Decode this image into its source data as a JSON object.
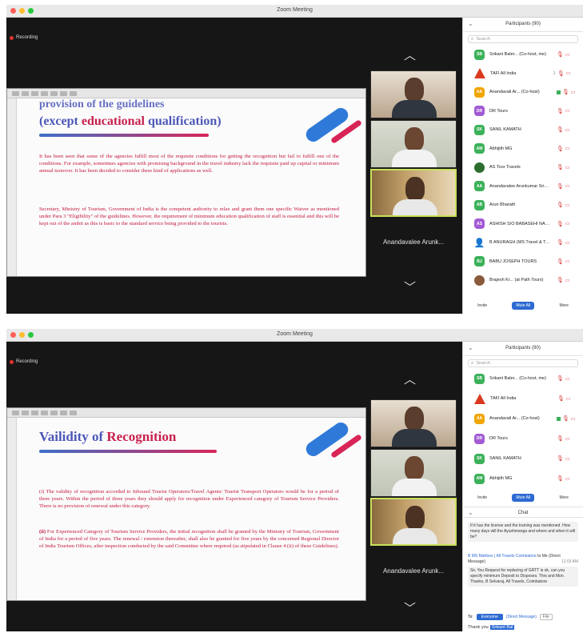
{
  "window_title": "Zoom Meeting",
  "recording_label": "Recording",
  "participants_title": "Participants (90)",
  "search_placeholder": "Search",
  "tile_name": "Anandavalee Arunk...",
  "footer": {
    "invite": "Invite",
    "mute_all": "Mute All",
    "more": "More"
  },
  "slide1": {
    "heading_line1": "provision of the guidelines",
    "heading_line2_a": "(except ",
    "heading_line2_b": "educational",
    "heading_line2_c": " qualification)",
    "para1": "It has been seen that some of the agencies fulfill most of the requisite conditions for getting the recognition but fail to fulfill one of the conditions. For example, sometimes agencies with promising background in the travel industry lack the requisite paid up capital or minimum annual turnover. It has been decided to consider these kind of applications as well.",
    "para2": "Secretary, Ministry of Tourism, Government of India is the competent authority to relax and grant them one specific Waiver as mentioned under Para 3 \"Eligibility\" of the guidelines. However, the requirement of minimum education qualification of staff is essential and this will be kept out of the ambit as this is basic to the standard service being provided to the tourists."
  },
  "slide2": {
    "heading_a": "Vailidity",
    "heading_b": " of ",
    "heading_c": "Recognition",
    "para1": "(i) The validity of recognition accorded to Inbound Tourist Operators/Travel Agents/ Tourist Transport Operators would be for a period of three years. Within the period of three years they should apply for recognition under Experienced category of Tourism Service Providers. There is no provision of renewal under this category.",
    "para2_lead": "(ii)",
    "para2": " For Experienced Category of Tourism Service Providers, the initial recognition shall be granted by the Ministry of Tourism, Government of India for a period of five years. The renewal / extension thereafter, shall also be granted for five years by the concerned Regional Director of India Tourism Offices, after inspection conducted by the said Committee where required (as stipulated in Clause 4 (ii) of these Guidelines)."
  },
  "participants1": [
    {
      "name": "Srikant Baler... (Co-host, me)",
      "avatar": "SB",
      "color": "#3cb15a",
      "type": "box",
      "badge": "",
      "cam": false
    },
    {
      "name": "TAFI All India",
      "avatar": "",
      "color": "#d93a1f",
      "type": "triangle",
      "badge": "1",
      "cam": false
    },
    {
      "name": "Anandavali Ar... (Co-host)",
      "avatar": "AA",
      "color": "#f0a500",
      "type": "box",
      "badge": "",
      "cam": true
    },
    {
      "name": "DR Tours",
      "avatar": "DR",
      "color": "#a25bd4",
      "type": "box",
      "badge": "",
      "cam": false
    },
    {
      "name": "SANIL KAMATH",
      "avatar": "SK",
      "color": "#3cb15a",
      "type": "box",
      "badge": "",
      "cam": false
    },
    {
      "name": "Abhijith MG",
      "avatar": "AM",
      "color": "#3cb15a",
      "type": "box",
      "badge": "",
      "cam": false
    },
    {
      "name": "AS Tour Travels",
      "avatar": "",
      "color": "#2b6e2f",
      "type": "photo",
      "badge": "",
      "cam": false
    },
    {
      "name": "Anandavalee Arunkumar Srikant",
      "avatar": "AA",
      "color": "#3cb15a",
      "type": "box",
      "badge": "",
      "cam": false
    },
    {
      "name": "Arun Bharath",
      "avatar": "AB",
      "color": "#3cb15a",
      "type": "box",
      "badge": "",
      "cam": false
    },
    {
      "name": "ASHISH S/O BABASEHI NANA",
      "avatar": "AS",
      "color": "#a25bd4",
      "type": "box",
      "badge": "",
      "cam": false
    },
    {
      "name": "B ANURAGH (MS Travel & Tours)",
      "avatar": "",
      "color": "#d9532f",
      "type": "person",
      "badge": "",
      "cam": false
    },
    {
      "name": "BABU JOSEPH TOURS",
      "avatar": "BJ",
      "color": "#3cb15a",
      "type": "box",
      "badge": "",
      "cam": false
    },
    {
      "name": "Brajesh Kr... (at Path Tours)",
      "avatar": "",
      "color": "#8a5a3a",
      "type": "photo",
      "badge": "",
      "cam": false
    }
  ],
  "participants2": [
    {
      "name": "Srikant Baler... (Co-host, me)",
      "avatar": "SB",
      "color": "#3cb15a",
      "type": "box",
      "badge": "",
      "cam": false
    },
    {
      "name": "TAFI All India",
      "avatar": "",
      "color": "#d93a1f",
      "type": "triangle",
      "badge": "",
      "cam": false
    },
    {
      "name": "Anandavali Ar... (Co-host)",
      "avatar": "AA",
      "color": "#f0a500",
      "type": "box",
      "badge": "",
      "cam": true
    },
    {
      "name": "DR Tours",
      "avatar": "DR",
      "color": "#a25bd4",
      "type": "box",
      "badge": "",
      "cam": false
    },
    {
      "name": "SANIL KAMATH",
      "avatar": "SK",
      "color": "#3cb15a",
      "type": "box",
      "badge": "",
      "cam": false
    },
    {
      "name": "Abhijith MG",
      "avatar": "AM",
      "color": "#3cb15a",
      "type": "box",
      "badge": "",
      "cam": false
    }
  ],
  "chat": {
    "title": "Chat",
    "msg1": "If it has the license and the training was mentioned. How many days will the Ayushmanga and where and when it will be?",
    "msg2_sender": "B MS Mahboo | All Travels Coimbatore",
    "msg2_to": " to Me (Direct Message)",
    "msg2_time": "11:03 AM",
    "msg2": "Sir, You Request for replacing of GRTT is ok, can you specify minimum Deposit to Disposes. Thrs and Mon. Thanks, B Selvaraj, All Travels, Coimbatore",
    "to_label": "To:",
    "to_button": "Everyone",
    "to_target": "(Direct Message)",
    "file_label": "File",
    "input_text": "Thank you",
    "input_mark": "Srikant Bal"
  }
}
